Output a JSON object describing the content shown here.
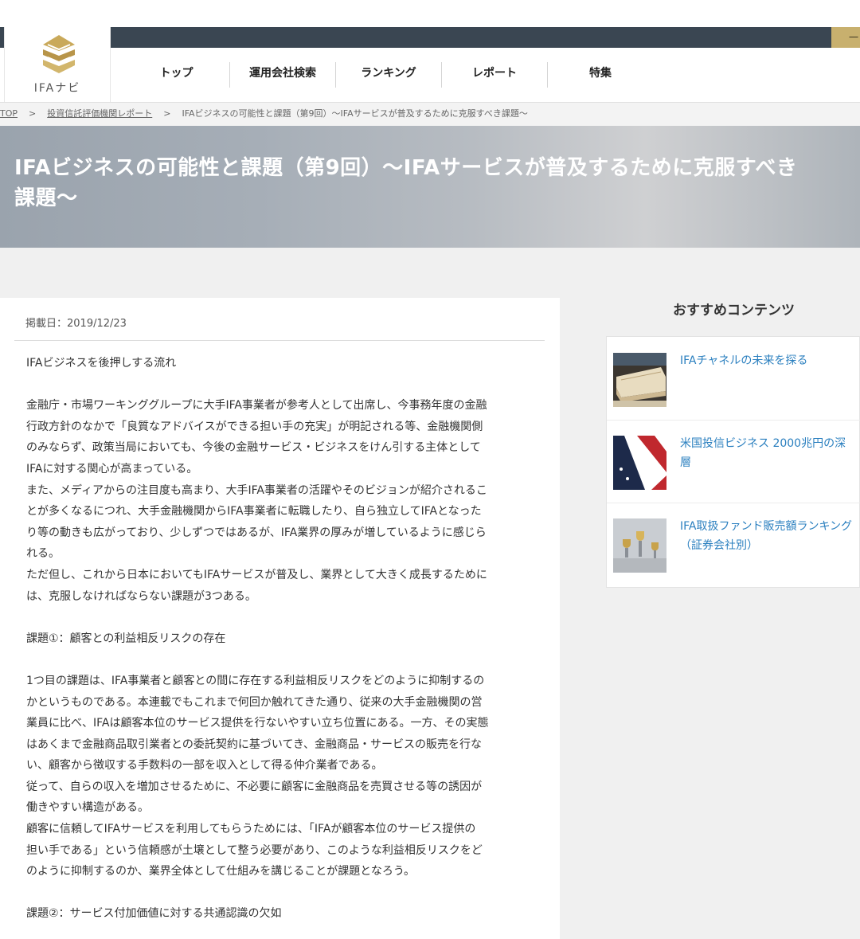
{
  "header": {
    "logo_text": "IFAナビ",
    "top_right_text": "一"
  },
  "nav": [
    {
      "label": "トップ"
    },
    {
      "label": "運用会社検索"
    },
    {
      "label": "ランキング"
    },
    {
      "label": "レポート"
    },
    {
      "label": "特集"
    }
  ],
  "breadcrumb": {
    "home": "TOP",
    "category": "投資信託評価機関レポート",
    "current": "IFAビジネスの可能性と課題（第9回）～IFAサービスが普及するために克服すべき課題～",
    "separator": ">"
  },
  "hero": {
    "title_line1": "IFAビジネスの可能性と課題（第9回）～IFAサービスが普及するために克服すべき",
    "title_line2": "課題～"
  },
  "article": {
    "date": "掲載日：2019/12/23",
    "lines": [
      "IFAビジネスを後押しする流れ",
      "",
      "金融庁・市場ワーキンググループに大手IFA事業者が参考人として出席し、今事務年度の金融",
      "行政方針のなかで「良質なアドバイスができる担い手の充実」が明記される等、金融機関側",
      "のみならず、政策当局においても、今後の金融サービス・ビジネスをけん引する主体として",
      "IFAに対する関心が高まっている。",
      "また、メディアからの注目度も高まり、大手IFA事業者の活躍やそのビジョンが紹介されるこ",
      "とが多くなるにつれ、大手金融機関からIFA事業者に転職したり、自ら独立してIFAとなった",
      "り等の動きも広がっており、少しずつではあるが、IFA業界の厚みが増しているように感じら",
      "れる。",
      "ただ但し、これから日本においてもIFAサービスが普及し、業界として大きく成長するために",
      "は、克服しなければならない課題が3つある。",
      "",
      "課題①：顧客との利益相反リスクの存在",
      "",
      "1つ目の課題は、IFA事業者と顧客との間に存在する利益相反リスクをどのように抑制するの",
      "かというものである。本連載でもこれまで何回か触れてきた通り、従来の大手金融機関の営",
      "業員に比べ、IFAは顧客本位のサービス提供を行ないやすい立ち位置にある。一方、その実態",
      "はあくまで金融商品取引業者との委託契約に基づいてき、金融商品・サービスの販売を行な",
      "い、顧客から徴収する手数料の一部を収入として得る仲介業者である。",
      "従って、自らの収入を増加させるために、不必要に顧客に金融商品を売買させる等の誘因が",
      "働きやすい構造がある。",
      "顧客に信頼してIFAサービスを利用してもらうためには、「IFAが顧客本位のサービス提供の",
      "担い手である」という信頼感が土壌として整う必要があり、このような利益相反リスクをど",
      "のように抑制するのか、業界全体として仕組みを講じることが課題となろう。",
      "",
      "課題②：サービス付加価値に対する共通認識の欠如"
    ]
  },
  "sidebar": {
    "title": "おすすめコンテンツ",
    "items": [
      {
        "label": "IFAチャネルの未来を探る"
      },
      {
        "label": "米国投信ビジネス 2000兆円の深層"
      },
      {
        "label": "IFA取扱ファンド販売額ランキング（証券会社別）"
      }
    ]
  },
  "colors": {
    "dark_bar": "#3a4652",
    "gold_accent": "#c8b06e",
    "link_blue": "#2a7fbf"
  }
}
